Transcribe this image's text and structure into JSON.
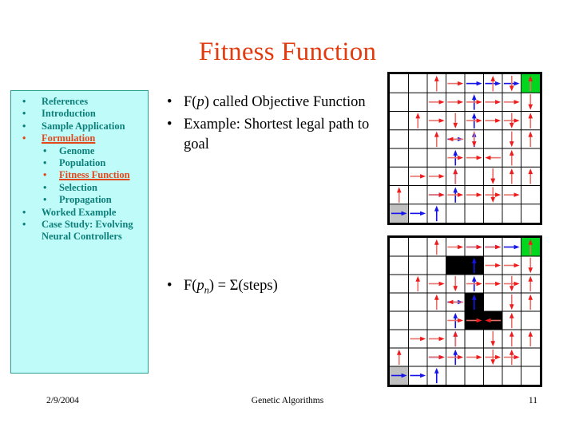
{
  "slide": {
    "title": "Fitness Function"
  },
  "sidebar": {
    "bullet_glyph": "•",
    "items": [
      {
        "label": "References",
        "level": 1,
        "active": false
      },
      {
        "label": "Introduction",
        "level": 1,
        "active": false
      },
      {
        "label": "Sample Application",
        "level": 1,
        "active": false
      },
      {
        "label": "Formulation",
        "level": 1,
        "active": true
      },
      {
        "label": "Genome",
        "level": 2,
        "active": false
      },
      {
        "label": "Population",
        "level": 2,
        "active": false
      },
      {
        "label": "Fitness Function",
        "level": 2,
        "active": true
      },
      {
        "label": "Selection",
        "level": 2,
        "active": false
      },
      {
        "label": "Propagation",
        "level": 2,
        "active": false
      },
      {
        "label": "Worked Example",
        "level": 1,
        "active": false
      },
      {
        "label": "Case Study: Evolving Neural Controllers",
        "level": 1,
        "active": false
      }
    ]
  },
  "content": {
    "bullet_glyph": "•",
    "top_bullets": [
      {
        "html": "F(<i>p</i>) called Objective Function"
      },
      {
        "html": "Example: Shortest legal path to goal"
      }
    ],
    "mid_bullets": [
      {
        "html": "F(<i>p</i><sub>n</sub>) = Σ(steps)"
      }
    ]
  },
  "mazes": {
    "grid_size": 8,
    "start_cell": {
      "col": 0,
      "row": 7,
      "color": "#C0C0C0"
    },
    "goal_cell": {
      "col": 7,
      "row": 0,
      "color": "#00D71E"
    },
    "path_colors": {
      "red": "#EE1C1C",
      "blue": "#1515E8",
      "line_red": "#E8726B",
      "line_blue": "#1515E8"
    },
    "top": {
      "name": "maze-open",
      "obstacles": []
    },
    "bottom": {
      "name": "maze-with-obstacles",
      "obstacles": [
        {
          "col": 3,
          "row": 1
        },
        {
          "col": 4,
          "row": 1
        },
        {
          "col": 4,
          "row": 3
        },
        {
          "col": 4,
          "row": 4
        },
        {
          "col": 5,
          "row": 4
        }
      ]
    }
  },
  "footer": {
    "date": "2/9/2004",
    "center": "Genetic Algorithms",
    "page": "11"
  }
}
